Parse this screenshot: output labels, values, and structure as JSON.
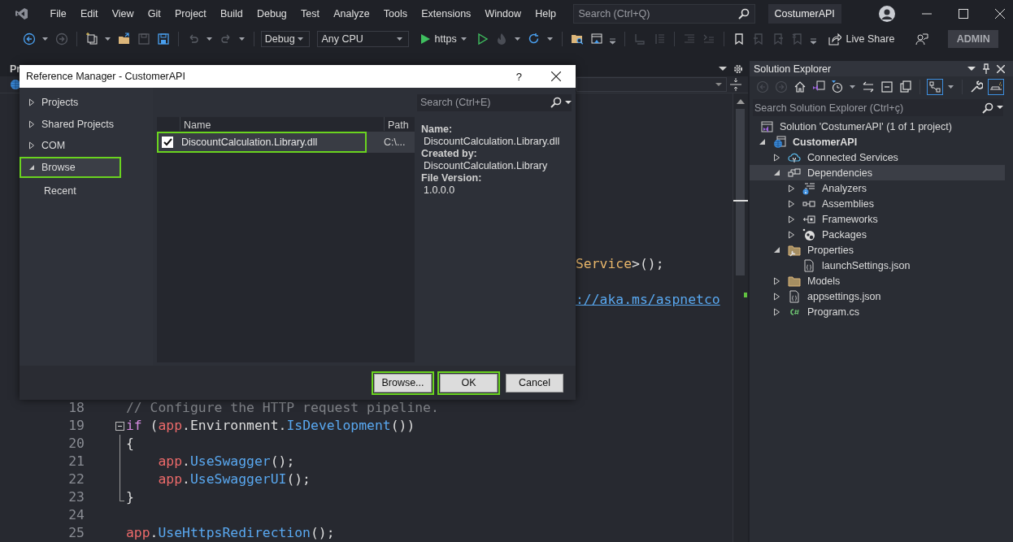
{
  "menu_bar": {
    "items": [
      "File",
      "Edit",
      "View",
      "Git",
      "Project",
      "Build",
      "Debug",
      "Test",
      "Analyze",
      "Tools",
      "Extensions",
      "Window",
      "Help"
    ],
    "search": {
      "placeholder": "Search (Ctrl+Q)"
    },
    "solution_name": "CostumerAPI"
  },
  "toolbar": {
    "configuration": "Debug",
    "platform": "Any CPU",
    "run_target": "https",
    "live_share": "Live Share",
    "account": "ADMIN"
  },
  "editor": {
    "tab_label": "Pr",
    "fragments": [
      [
        {
          "kind": "type",
          "text": "Service"
        },
        {
          "kind": "plain",
          "text": ">();"
        }
      ],
      [
        {
          "kind": "link",
          "text": "://aka.ms/aspnetco"
        }
      ]
    ],
    "lines": [
      {
        "number": "18",
        "tokens": [
          {
            "kind": "comment",
            "text": "// Configure the HTTP request pipeline."
          }
        ]
      },
      {
        "number": "19",
        "kind": "fold_start",
        "tokens": [
          {
            "kind": "keyword",
            "text": "if"
          },
          {
            "kind": "plain",
            "text": " ("
          },
          {
            "kind": "variable",
            "text": "app"
          },
          {
            "kind": "plain",
            "text": ".Environment."
          },
          {
            "kind": "method",
            "text": "IsDevelopment"
          },
          {
            "kind": "plain",
            "text": "())"
          }
        ]
      },
      {
        "number": "20",
        "kind": "fold_inside",
        "tokens": [
          {
            "kind": "plain",
            "text": "{"
          }
        ]
      },
      {
        "number": "21",
        "kind": "fold_inside",
        "indented": true,
        "tokens": [
          {
            "kind": "variable",
            "text": "app"
          },
          {
            "kind": "plain",
            "text": "."
          },
          {
            "kind": "method",
            "text": "UseSwagger"
          },
          {
            "kind": "plain",
            "text": "();"
          }
        ]
      },
      {
        "number": "22",
        "kind": "fold_inside",
        "indented": true,
        "tokens": [
          {
            "kind": "variable",
            "text": "app"
          },
          {
            "kind": "plain",
            "text": "."
          },
          {
            "kind": "method",
            "text": "UseSwaggerUI"
          },
          {
            "kind": "plain",
            "text": "();"
          }
        ]
      },
      {
        "number": "23",
        "kind": "fold_end",
        "tokens": [
          {
            "kind": "plain",
            "text": "}"
          }
        ]
      },
      {
        "number": "24"
      },
      {
        "number": "25",
        "tokens": [
          {
            "kind": "variable",
            "text": "app"
          },
          {
            "kind": "plain",
            "text": "."
          },
          {
            "kind": "method",
            "text": "UseHttpsRedirection"
          },
          {
            "kind": "plain",
            "text": "();"
          }
        ]
      }
    ]
  },
  "dialog": {
    "title": "Reference Manager - CustomerAPI",
    "help": "?",
    "nav": [
      {
        "label": "Projects",
        "expanded": false,
        "selected": false,
        "highlighted": false
      },
      {
        "label": "Shared Projects",
        "expanded": false,
        "selected": false,
        "highlighted": false
      },
      {
        "label": "COM",
        "expanded": false,
        "selected": false,
        "highlighted": false
      },
      {
        "label": "Browse",
        "expanded": true,
        "selected": true,
        "highlighted": true,
        "children": [
          {
            "label": "Recent",
            "selected": false
          }
        ]
      }
    ],
    "search": {
      "placeholder": "Search (Ctrl+E)"
    },
    "columns": [
      "Name",
      "Path"
    ],
    "rows": [
      {
        "checked": true,
        "name": "DiscountCalculation.Library.dll",
        "path": "C:\\...",
        "selected": true,
        "highlighted": true
      }
    ],
    "details": [
      {
        "label": "Name:",
        "value": "DiscountCalculation.Library.dll"
      },
      {
        "label": "Created by:",
        "value": "DiscountCalculation.Library"
      },
      {
        "label": "File Version:",
        "value": "1.0.0.0"
      }
    ],
    "buttons": [
      {
        "label": "Browse...",
        "highlighted": true
      },
      {
        "label": "OK",
        "highlighted": true
      },
      {
        "label": "Cancel",
        "highlighted": false
      }
    ]
  },
  "solution_explorer": {
    "title": "Solution Explorer",
    "search": {
      "placeholder": "Search Solution Explorer (Ctrl+ç)"
    },
    "tree": [
      {
        "label": "Solution 'CostumerAPI' (1 of 1 project)",
        "kind": "solution",
        "selected": false,
        "children": [
          {
            "label": "CustomerAPI",
            "kind": "project",
            "expanded": true,
            "selected": false,
            "children": [
              {
                "label": "Connected Services",
                "kind": "services",
                "expanded": false,
                "selected": false
              },
              {
                "label": "Dependencies",
                "kind": "dependencies",
                "expanded": true,
                "selected": true,
                "children": [
                  {
                    "label": "Analyzers",
                    "kind": "analyzers",
                    "expanded": false,
                    "selected": false
                  },
                  {
                    "label": "Assemblies",
                    "kind": "assemblies",
                    "expanded": false,
                    "selected": false
                  },
                  {
                    "label": "Frameworks",
                    "kind": "frameworks",
                    "expanded": false,
                    "selected": false
                  },
                  {
                    "label": "Packages",
                    "kind": "packages",
                    "expanded": false,
                    "selected": false
                  }
                ]
              },
              {
                "label": "Properties",
                "kind": "properties",
                "expanded": true,
                "selected": false,
                "children": [
                  {
                    "label": "launchSettings.json",
                    "kind": "json",
                    "selected": false
                  }
                ]
              },
              {
                "label": "Models",
                "kind": "folder",
                "expanded": false,
                "selected": false
              },
              {
                "label": "appsettings.json",
                "kind": "json",
                "expanded": false,
                "selected": false
              },
              {
                "label": "Program.cs",
                "kind": "csharp",
                "expanded": false,
                "selected": false
              }
            ]
          }
        ]
      }
    ]
  }
}
